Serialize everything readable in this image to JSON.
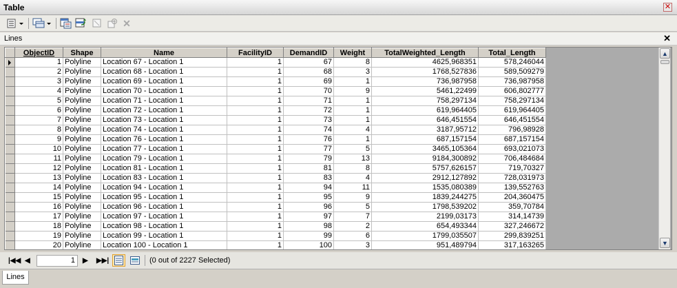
{
  "window": {
    "title": "Table"
  },
  "table_tab": {
    "label": "Lines"
  },
  "columns": [
    "ObjectID",
    "Shape",
    "Name",
    "FacilityID",
    "DemandID",
    "Weight",
    "TotalWeighted_Length",
    "Total_Length"
  ],
  "rows": [
    [
      "1",
      "Polyline",
      "Location 67 - Location 1",
      "1",
      "67",
      "8",
      "4625,968351",
      "578,246044"
    ],
    [
      "2",
      "Polyline",
      "Location 68 - Location 1",
      "1",
      "68",
      "3",
      "1768,527836",
      "589,509279"
    ],
    [
      "3",
      "Polyline",
      "Location 69 - Location 1",
      "1",
      "69",
      "1",
      "736,987958",
      "736,987958"
    ],
    [
      "4",
      "Polyline",
      "Location 70 - Location 1",
      "1",
      "70",
      "9",
      "5461,22499",
      "606,802777"
    ],
    [
      "5",
      "Polyline",
      "Location 71 - Location 1",
      "1",
      "71",
      "1",
      "758,297134",
      "758,297134"
    ],
    [
      "6",
      "Polyline",
      "Location 72 - Location 1",
      "1",
      "72",
      "1",
      "619,964405",
      "619,964405"
    ],
    [
      "7",
      "Polyline",
      "Location 73 - Location 1",
      "1",
      "73",
      "1",
      "646,451554",
      "646,451554"
    ],
    [
      "8",
      "Polyline",
      "Location 74 - Location 1",
      "1",
      "74",
      "4",
      "3187,95712",
      "796,98928"
    ],
    [
      "9",
      "Polyline",
      "Location 76 - Location 1",
      "1",
      "76",
      "1",
      "687,157154",
      "687,157154"
    ],
    [
      "10",
      "Polyline",
      "Location 77 - Location 1",
      "1",
      "77",
      "5",
      "3465,105364",
      "693,021073"
    ],
    [
      "11",
      "Polyline",
      "Location 79 - Location 1",
      "1",
      "79",
      "13",
      "9184,300892",
      "706,484684"
    ],
    [
      "12",
      "Polyline",
      "Location 81 - Location 1",
      "1",
      "81",
      "8",
      "5757,626157",
      "719,70327"
    ],
    [
      "13",
      "Polyline",
      "Location 83 - Location 1",
      "1",
      "83",
      "4",
      "2912,127892",
      "728,031973"
    ],
    [
      "14",
      "Polyline",
      "Location 94 - Location 1",
      "1",
      "94",
      "11",
      "1535,080389",
      "139,552763"
    ],
    [
      "15",
      "Polyline",
      "Location 95 - Location 1",
      "1",
      "95",
      "9",
      "1839,244275",
      "204,360475"
    ],
    [
      "16",
      "Polyline",
      "Location 96 - Location 1",
      "1",
      "96",
      "5",
      "1798,539202",
      "359,70784"
    ],
    [
      "17",
      "Polyline",
      "Location 97 - Location 1",
      "1",
      "97",
      "7",
      "2199,03173",
      "314,14739"
    ],
    [
      "18",
      "Polyline",
      "Location 98 - Location 1",
      "1",
      "98",
      "2",
      "654,493344",
      "327,246672"
    ],
    [
      "19",
      "Polyline",
      "Location 99 - Location 1",
      "1",
      "99",
      "6",
      "1799,035507",
      "299,839251"
    ],
    [
      "20",
      "Polyline",
      "Location 100 - Location 1",
      "1",
      "100",
      "3",
      "951,489794",
      "317,163265"
    ]
  ],
  "navigation": {
    "current_record": "1",
    "selection_status": "(0 out of 2227 Selected)",
    "first_icon": "first-record-icon",
    "prev_icon": "previous-record-icon",
    "next_icon": "next-record-icon",
    "last_icon": "last-record-icon"
  },
  "bottom_tabs": [
    {
      "label": "Lines"
    }
  ],
  "icons": {
    "table_options": "table-options-icon",
    "related_tables": "related-tables-icon",
    "select_by_attributes": "select-by-attributes-icon",
    "switch_selection": "switch-selection-icon",
    "clear_selection": "clear-selection-icon",
    "zoom_to_selected": "zoom-to-selected-icon",
    "delete_selected": "delete-selected-icon"
  },
  "colors": {
    "selection_highlight": "#ffe8b0",
    "close_button": "#cc0000"
  }
}
